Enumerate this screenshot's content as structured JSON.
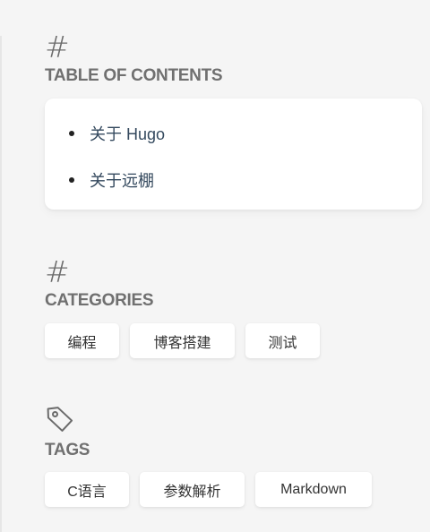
{
  "toc": {
    "icon": "hash-icon",
    "title": "TABLE OF CONTENTS",
    "items": [
      {
        "label": "关于 Hugo"
      },
      {
        "label": "关于远棚"
      }
    ]
  },
  "categories": {
    "icon": "hash-icon",
    "title": "CATEGORIES",
    "items": [
      {
        "label": "编程"
      },
      {
        "label": "博客搭建"
      },
      {
        "label": "测试"
      }
    ]
  },
  "tags": {
    "icon": "tag-icon",
    "title": "TAGS",
    "items": [
      {
        "label": "C语言"
      },
      {
        "label": "参数解析"
      },
      {
        "label": "Markdown"
      }
    ]
  },
  "colors": {
    "background": "#f5f5f5",
    "card": "#ffffff",
    "heading": "#707070",
    "link": "#34495e"
  }
}
